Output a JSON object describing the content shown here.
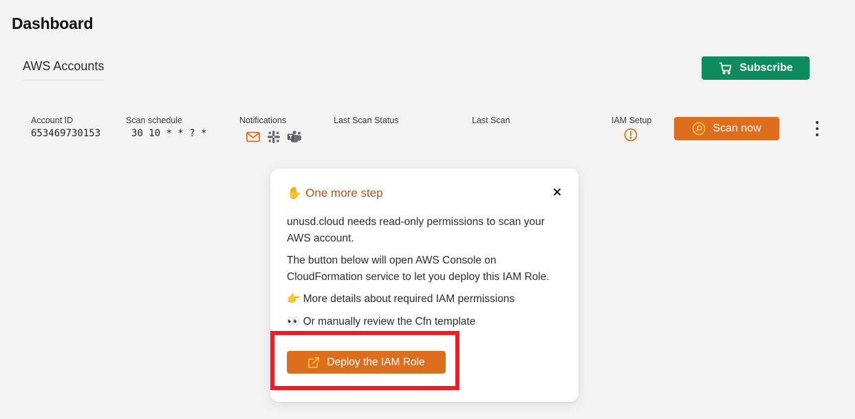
{
  "page": {
    "title": "Dashboard"
  },
  "tabs": [
    {
      "label": "AWS Accounts"
    }
  ],
  "subscribe": {
    "label": "Subscribe",
    "icon": "cart-icon",
    "color": "#0e8a5f"
  },
  "account_row": {
    "columns": {
      "account_id": {
        "label": "Account ID",
        "value": "653469730153"
      },
      "scan_schedule": {
        "label": "Scan schedule",
        "value": "30 10 * * ? *"
      },
      "notifications": {
        "label": "Notifications",
        "icons": [
          "mail-icon",
          "slack-icon",
          "teams-icon"
        ]
      },
      "last_scan_status": {
        "label": "Last Scan Status"
      },
      "last_scan": {
        "label": "Last Scan"
      },
      "iam_setup": {
        "label": "IAM Setup",
        "icon": "warning-circle-icon"
      }
    },
    "scan_button": {
      "label": "Scan now",
      "icon": "scan-icon",
      "color": "#dd6e1e"
    }
  },
  "popover": {
    "title_emoji": "✋",
    "title": "One more step",
    "paragraph1": "unusd.cloud needs read-only permissions to scan your AWS account.",
    "paragraph2": "The button below will open AWS Console on CloudFormation service to let you deploy this IAM Role.",
    "link1_emoji": "👉",
    "link1": "More details about required IAM permissions",
    "link2_emoji": "👀",
    "link2": "Or manually review the Cfn template",
    "deploy_button": {
      "label": "Deploy the IAM Role",
      "icon": "external-link-icon"
    }
  },
  "colors": {
    "accent_orange": "#dd6e1e",
    "title_orange": "#b5501a",
    "highlight_red": "#f51b22"
  }
}
